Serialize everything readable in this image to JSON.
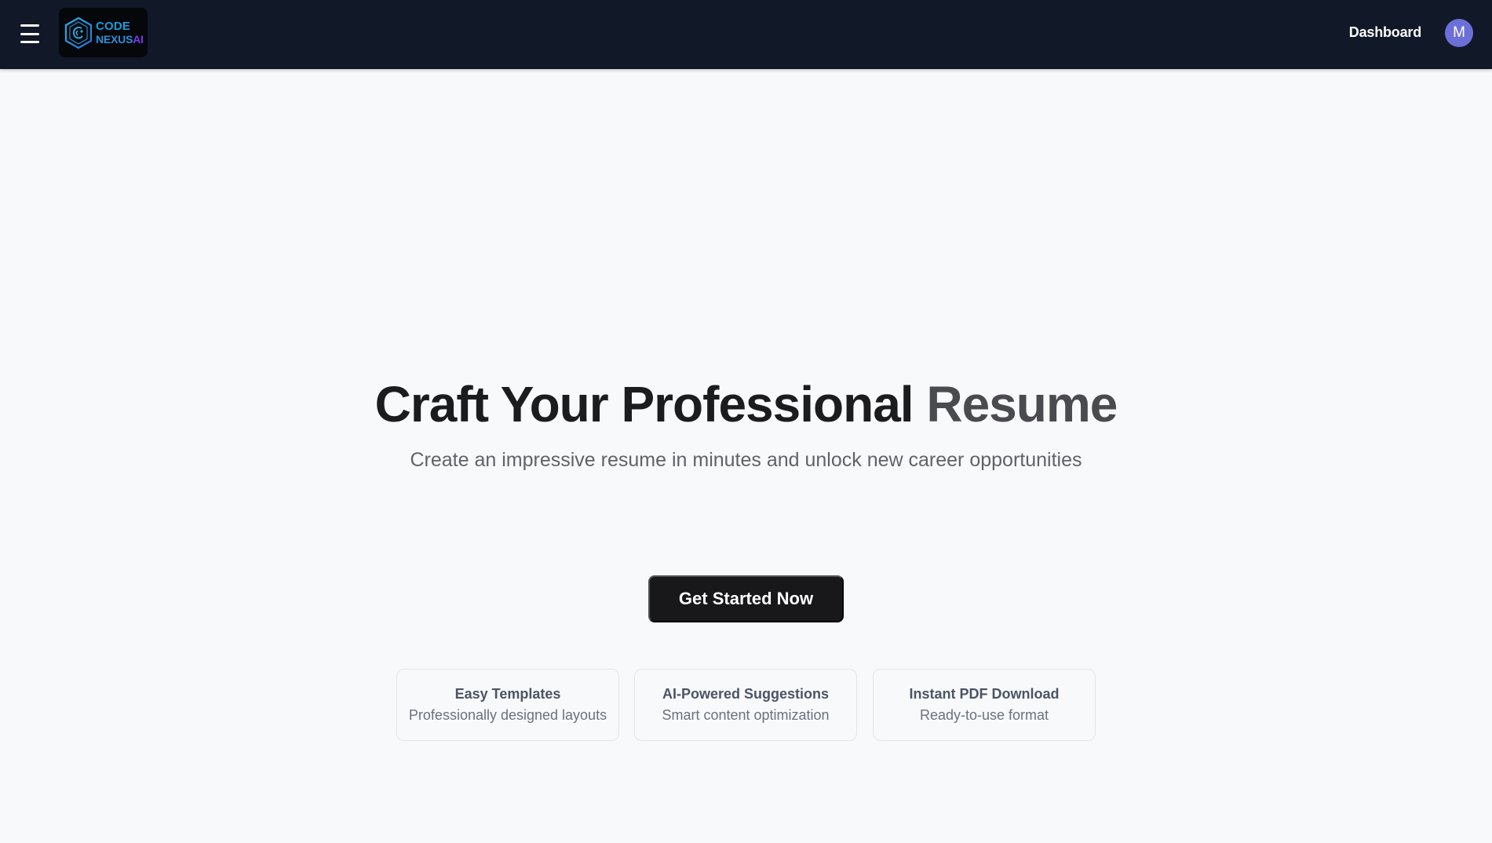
{
  "header": {
    "logo": {
      "line1": "CODE",
      "line2a": "NEXUS",
      "line2b": "AI"
    },
    "nav_dashboard": "Dashboard",
    "avatar_initial": "M",
    "icons": {
      "menu": "hamburger-menu-icon",
      "logo": "hexagon-code-logo-icon"
    }
  },
  "hero": {
    "title_part1": "Craft Your Professional ",
    "title_part2": "Resume",
    "subtitle": "Create an impressive resume in minutes and unlock new career opportunities",
    "cta_label": "Get Started Now"
  },
  "features": [
    {
      "title": "Easy Templates",
      "description": "Professionally designed layouts"
    },
    {
      "title": "AI-Powered Suggestions",
      "description": "Smart content optimization"
    },
    {
      "title": "Instant PDF Download",
      "description": "Ready-to-use format"
    }
  ],
  "colors": {
    "header_bg": "#111827",
    "page_bg": "#f8f9fb",
    "avatar_bg": "#6d6fd8",
    "cta_bg": "#18181b",
    "logo_blue": "#1e9bd7",
    "logo_purple": "#7c3aed"
  }
}
